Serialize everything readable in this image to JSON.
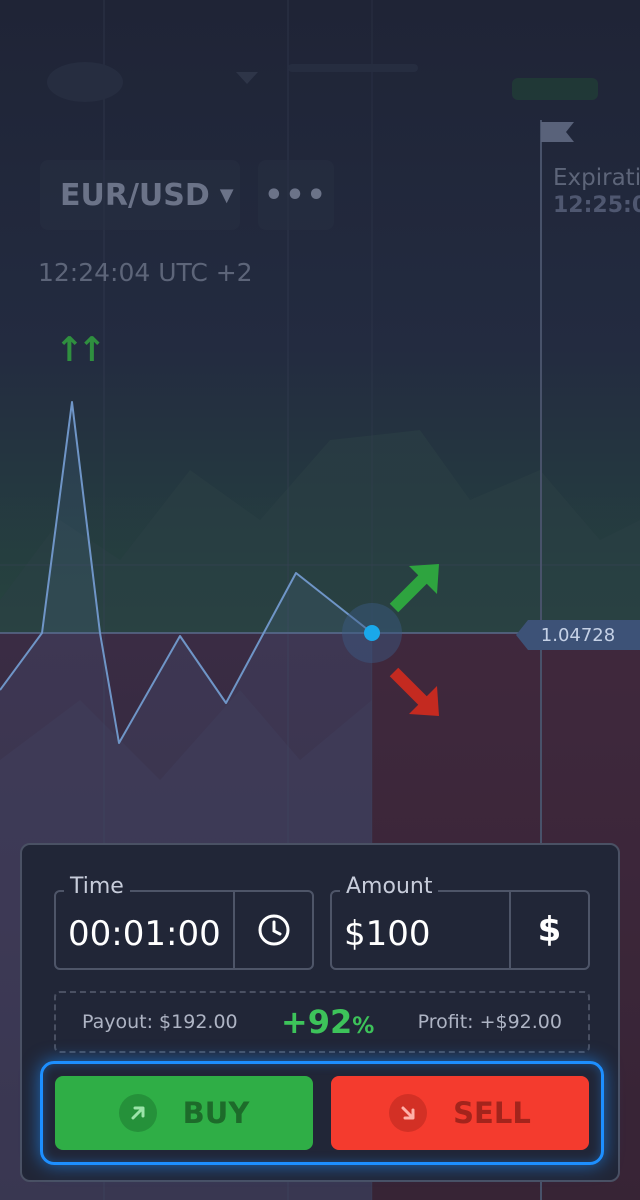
{
  "asset": {
    "pair": "EUR/USD",
    "more_label": "•••"
  },
  "clock": {
    "time_text": "12:24:04 UTC +2"
  },
  "expiration": {
    "label": "Expiratio",
    "time": "12:25:0"
  },
  "trend": {
    "glyph": "↑↑"
  },
  "price": {
    "current": "1.04728"
  },
  "trade": {
    "time_label": "Time",
    "time_value": "00:01:00",
    "amount_label": "Amount",
    "amount_value": "$100",
    "amount_icon": "$",
    "payout_text": "Payout: $192.00",
    "payout_pct": "+92",
    "payout_pct_unit": "%",
    "profit_text": "Profit: +$92.00",
    "buy_label": "BUY",
    "sell_label": "SELL"
  },
  "colors": {
    "buy": "#2fae46",
    "sell": "#f43b2e",
    "accent": "#1d8fff",
    "line": "#6f95c7",
    "marker": "#1aa8ea"
  },
  "icons": {
    "time_field": "clock-icon",
    "amount_field": "dollar-icon",
    "buy": "arrow-up-right-icon",
    "sell": "arrow-down-right-icon"
  }
}
